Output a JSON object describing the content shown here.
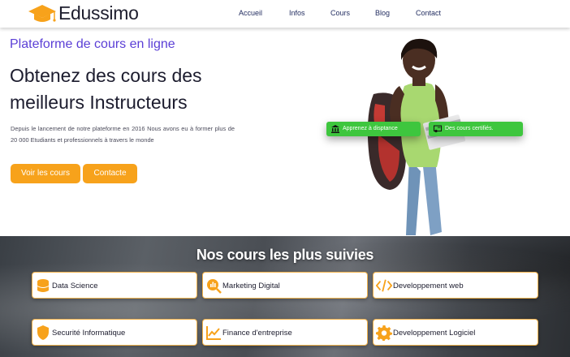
{
  "brand": {
    "name": "Edussimo",
    "accent": "#f7a21b",
    "icon": "graduation-cap-icon"
  },
  "nav": {
    "items": [
      "Accueil",
      "Infos",
      "Cours",
      "Blog",
      "Contact"
    ]
  },
  "hero": {
    "subtitle": "Plateforme de cours en ligne",
    "title_line1": "Obtenez des cours des",
    "title_line2": "meilleurs Instructeurs",
    "description": "Depuis le lancement de notre plateforme en 2016 Nous avons eu à former plus de 20 000 Etudiants et professionnels à travers le monde",
    "buttons": {
      "courses": "Voir les cours",
      "contact": "Contacte"
    },
    "badges": [
      {
        "label": "Apprenez à disptance",
        "icon": "bank-icon"
      },
      {
        "label": "Des cours certifiés.",
        "icon": "certificate-icon"
      }
    ],
    "badge_color": "#3ec63e"
  },
  "courses": {
    "title": "Nos cours les plus suivies",
    "items": [
      {
        "label": "Data Science",
        "icon": "database-icon"
      },
      {
        "label": "Marketing Digital",
        "icon": "chart-search-icon"
      },
      {
        "label": "Developpement web",
        "icon": "code-icon"
      },
      {
        "label": "Securité Informatique",
        "icon": "shield-icon"
      },
      {
        "label": "Finance d'entreprise",
        "icon": "line-chart-icon"
      },
      {
        "label": "Developpement Logiciel",
        "icon": "gear-icon"
      }
    ]
  }
}
